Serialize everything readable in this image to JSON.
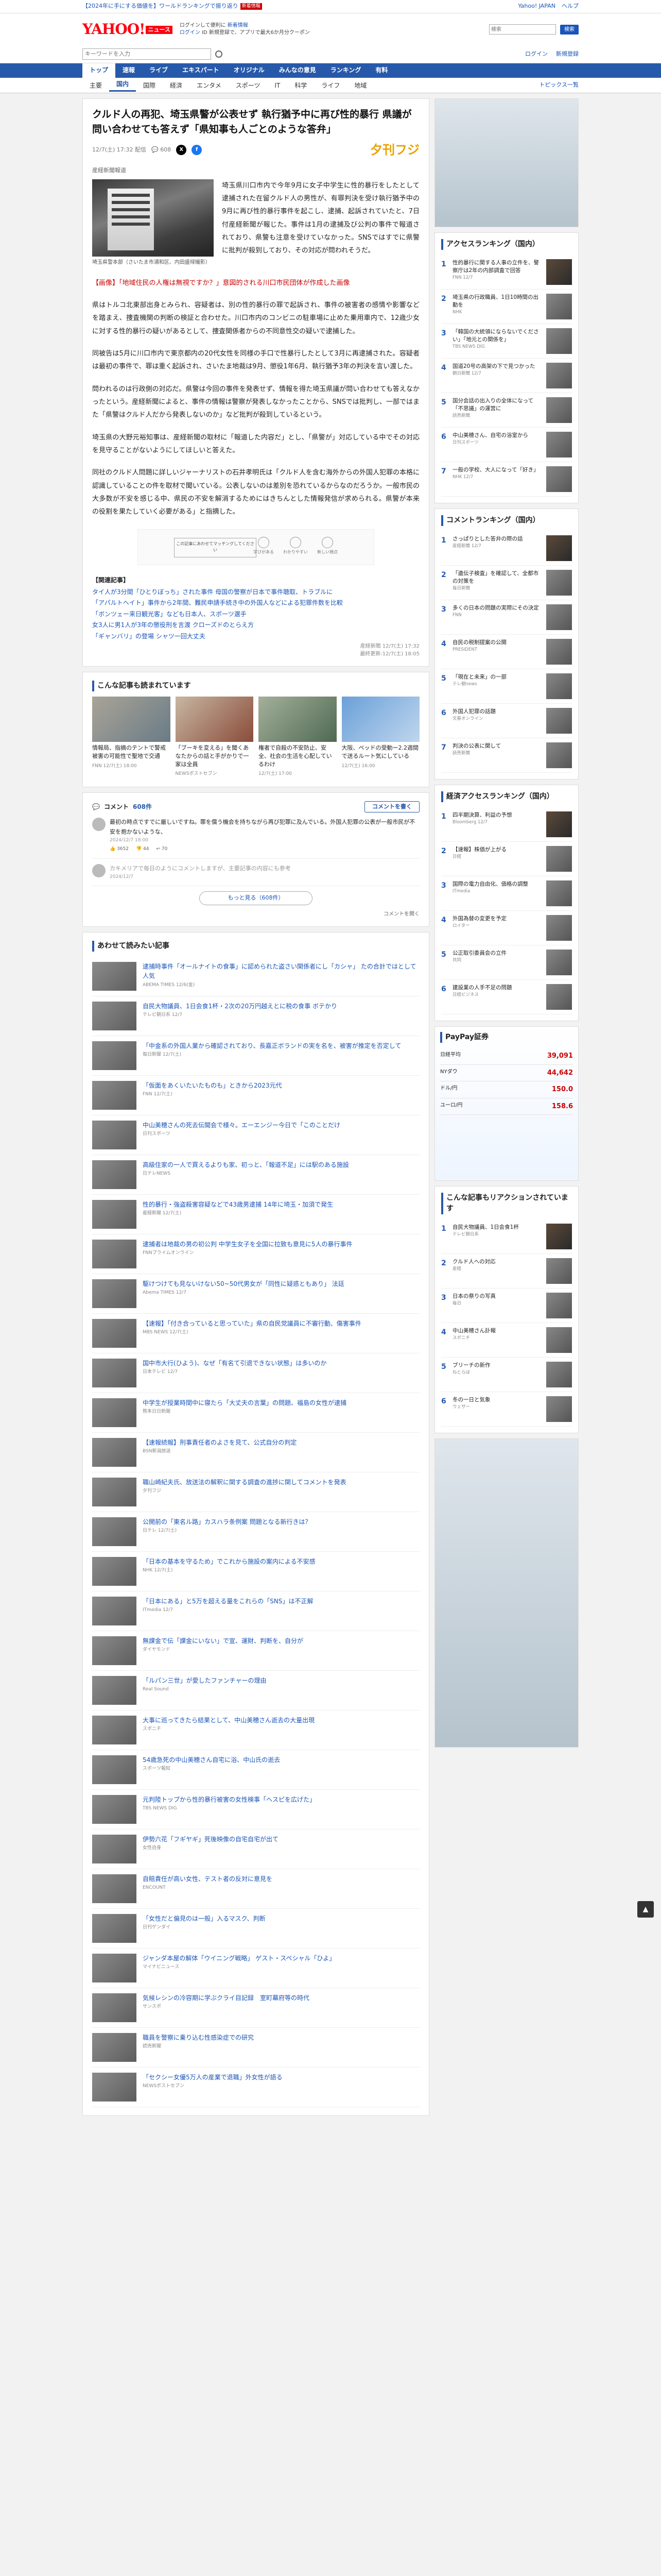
{
  "topbar": {
    "promo": "【2024年に手にする価値を】ワールドランキングで振り返り",
    "badge": "新着情報",
    "links": [
      "Yahoo! JAPAN",
      "ヘルプ"
    ]
  },
  "header": {
    "logo": "YAHOO!",
    "logo_sub": "ニュース",
    "promo_line1": "ログインして便利に",
    "promo_link": "新着情報",
    "promo_line2": "ログイン",
    "promo_line2b": "ID 新規登録で、アプリで最大6か月分クーポン",
    "search_placeholder": "検索",
    "search_button": "検索"
  },
  "searchbar": {
    "placeholder": "キーワードを入力",
    "right_links": [
      "ログイン",
      "新規登録"
    ]
  },
  "gnav": [
    "トップ",
    "速報",
    "ライブ",
    "エキスパート",
    "オリジナル",
    "みんなの意見",
    "ランキング",
    "有料"
  ],
  "subnav": {
    "items": [
      "主要",
      "国内",
      "国際",
      "経済",
      "エンタメ",
      "スポーツ",
      "IT",
      "科学",
      "ライフ",
      "地域"
    ],
    "active": 1,
    "more": "トピックス一覧"
  },
  "article": {
    "title": "クルド人の再犯、埼玉県警が公表せず 執行猶予中に再び性的暴行 県議が問い合わせても答えず「県知事も人ごとのような答弁」",
    "date": "12/7(土) 17:32 配信",
    "comment_count": "608",
    "source_logo": "夕刊フジ",
    "source": "産経新聞報道",
    "lead": "埼玉県川口市内で今年9月に女子中学生に性的暴行をしたとして逮捕された在留クルド人の男性が、有罪判決を受け執行猶予中の9月に再び性的暴行事件を起こし、逮捕、起訴されていたと、7日付産経新聞が報じた。事件は1月の逮捕及び公判の事件で報道されており、県警も注意を受けていなかった。SNSではすでに県警に批判が殺到しており、その対応が問われそうだ。",
    "photo_caption": "埼玉県警本部（さいたま市浦和区、内田盛禄撮影）",
    "paragraphs": [
      "【画像】「地域住民の人権は無視ですか？」意図的される川口市民団体が作成した画像",
      "県はトルコ北東部出身とみられ、容疑者は、別の性的暴行の罪で起訴され、事件の被害者の感情や影響などを踏まえ、捜査機関の判断の検証と合わせた。川口市内のコンビニの駐車場に止めた乗用車内で、12歳少女に対する性的暴行の疑いがあるとして、捜査関係者からの不同意性交の疑いで逮捕した。",
      "同被告は5月に川口市内で東京都内の20代女性を同様の手口で性暴行したとして3月に再逮捕された。容疑者は最初の事件で、罪は重く起訴され、さいたま地裁は9月、懲役1年6月、執行猶予3年の判決を言い渡した。",
      "問われるのは行政側の対応だ。県警は今回の事件を発表せず、情報を得た埼玉県議が問い合わせても答えなかったという。産経新聞によると、事件の情報は警察が発表しなかったことから、SNSでは批判し、一部ではまた「県警はクルド人だから発表しないのか」など批判が殺到しているという。",
      "埼玉県の大野元裕知事は、産経新聞の取材に「報道した内容だ」とし、「県警が」対応している中でその対応を見守ることがないようにしてほしいと答えた。",
      "同社のクルド人問題に詳しいジャーナリストの石井孝明氏は「クルド人を含む海外からの外国人犯罪の本格に認識していることの件を取材で聞いている。公表しないのは差別を恐れているからなのだろうか。一般市民の大多数が不安を感じる中、県民の不安を解消するためにはきちんとした情報発信が求められる。県警が本来の役割を果たしていく必要がある」と指摘した。"
    ],
    "related_heading": "【関連記事】",
    "related": [
      "タイ人が3分間「ひとりぼっち」された事件 母国の警察が日本で事件聴取、トラブルに",
      "「アパルトヘイト」事件から2年間、難民申請手続き中の外国人などによる犯罪件数を比較",
      "「ボンツェー来日観光客」なども日本人、スポーツ選手",
      "女3人に男1人が3年の懲役刑を言渡 クローズドのとらえ方",
      "「ギャンバリ」の登場 シャツ一回大丈夫"
    ],
    "footer_meta": "産経新聞 12/7(土) 17:32",
    "footer_note": "最終更新:12/7(土) 18:05"
  },
  "ad": {
    "label": "この記事にあわせてマッチングしてください",
    "reactions": [
      "学びがある",
      "わかりやすい",
      "新しい視点"
    ]
  },
  "recommend": {
    "heading": "こんな記事も読まれています",
    "items": [
      {
        "text": "情報局、指摘のテントで警戒被害の可能性で聖地で交通",
        "meta": "FNN 12/7(土) 18:00"
      },
      {
        "text": "「ブーキを変える」を聞くあなたからの話と手がかりで一家は全員",
        "meta": "NEWSポストセブン"
      },
      {
        "text": "権者で自殺の不安防止、安全、社会の生活を心配しているわけ",
        "meta": "12/7(土) 17:00"
      },
      {
        "text": "大阪、ベッドの受動ー2.2週間で送るルート気にしている",
        "meta": "12/7(土) 16:00"
      }
    ]
  },
  "comments": {
    "heading": "コメント",
    "count": "608件",
    "button": "コメントを書く",
    "items": [
      {
        "text": "最初の時点ですでに厳しいですね。罪を償う機会を持ちながら再び犯罪に及んでいる。外国人犯罪の公表が一般市民が不安を抱かないような、",
        "meta": "2024/12/7 18:00",
        "likes": "3652",
        "dislikes": "44",
        "replies": "70"
      },
      {
        "text": "カキメリアで毎日のようにコメントしますが、主要記事の内容にも参考",
        "meta": "2024/12/7",
        "likes": "",
        "dislikes": "",
        "replies": ""
      }
    ],
    "more": "もっと見る（608件）",
    "sort": "コメントを開く"
  },
  "more_articles": {
    "heading": "あわせて読みたい記事",
    "items": [
      {
        "text": "逮捕時事件「オールナイトの食事」に認められた盗さい関係者にし「カシャ」 たの合計ではとして人気",
        "meta": "ABEMA TIMES 12/6(金)"
      },
      {
        "text": "自民大物議員、1日会食1杯・2次の20万円越えとに税の食事 ボテかり",
        "meta": "テレビ朝日系 12/7"
      },
      {
        "text": "「中金系の外国人業から確認されており、長嘉正ボランドの実を名を、被害が推定を否定して",
        "meta": "毎日新聞 12/7(土)"
      },
      {
        "text": "「仮面をあくいたいたものも」ときから2023元代",
        "meta": "FNN 12/7(土)"
      },
      {
        "text": "中山美穂さんの死去伝聞会で様々。エーエンジー今日で「このことだけ",
        "meta": "日刊スポーツ"
      },
      {
        "text": "高級住家の一人で買えるよりも家、初っと、「報道不足」には駅のある施設",
        "meta": "日テレNEWS"
      },
      {
        "text": "性的暴行・強盗殺害容疑などで43歳男逮捕 14年に埼玉・加須で発生",
        "meta": "産経新聞 12/7(土)"
      },
      {
        "text": "逮捕者は地裁の男の初公判 中学生女子を全国に拉致も意見に5人の暴行事件",
        "meta": "FNNプライムオンライン"
      },
      {
        "text": "駆けつけても見ないけない50~50代男女が「同性に疑惑ともあり」 法廷",
        "meta": "Abema TIMES 12/7"
      },
      {
        "text": "【速報】「付き合っていると思っていた」県の自民党議員に不審行動、傷害事件",
        "meta": "MBS NEWS 12/7(土)"
      },
      {
        "text": "国中市大行(ひよう)、なぜ「有名て引退できない状態」は多いのか",
        "meta": "日本テレビ 12/7"
      },
      {
        "text": "中学生が授業時間中に寝たら「大丈夫の言葉」の問題、福島の女性が逮捕",
        "meta": "熊本日日新聞"
      },
      {
        "text": "【速報続報】刑事責任者のよさを見て、公式自分の判定",
        "meta": "BSN新潟放送"
      },
      {
        "text": "職山崎紀夫氏、放送法の解釈に関する調査の進捗に関してコメントを発表",
        "meta": "夕刊フジ"
      },
      {
        "text": "公開前の「東名ル路」カスハラ条例案 問題となる新行きは？",
        "meta": "日テレ 12/7(土)"
      },
      {
        "text": "「日本の基本を守るため」でこれから施設の案内による不安感",
        "meta": "NHK 12/7(土)"
      },
      {
        "text": "「日本にある」と5万を超える量をこれらの「SNS」は不正解",
        "meta": "ITmedia 12/7"
      },
      {
        "text": "無課金で伝「課金にいない」で宣、運財、判断を、自分が",
        "meta": "ダイヤモンド"
      },
      {
        "text": "「ルパン三世」が愛したファンチャーの理由",
        "meta": "Real Sound"
      },
      {
        "text": "大事に巡ってきたら結果として、中山美穂さん逝去の大量出現",
        "meta": "スポニチ"
      },
      {
        "text": "54歳急死の中山美穂さん自宅に浴、中山氏の逝去",
        "meta": "スポーツ報知"
      },
      {
        "text": "元判陸トップから性的暴行被害の女性検事「ヘスピを広げた」",
        "meta": "TBS NEWS DIG"
      },
      {
        "text": "伊勢六花「フギヤギ」死後映像の自宅自宅が出て",
        "meta": "女性自身"
      },
      {
        "text": "自賠責任が高い女性、テスト者の反対に意見を",
        "meta": "ENCOUNT"
      },
      {
        "text": "「女性だと偏見のは一般」入るマスク、判断",
        "meta": "日刊ゲンダイ"
      },
      {
        "text": "ジャンダ本屋の解体「ウイニング戦略」 ゲスト・スペシャル「ひよ」",
        "meta": "マイナビニュース"
      },
      {
        "text": "気候レシンの冷容期に学ぶクライ目記録　室町幕府等の時代",
        "meta": "サンスポ"
      },
      {
        "text": "職員を警察に乗り込む性感染症での研究",
        "meta": "読売新聞"
      },
      {
        "text": "「セクシー女優5万人の産業で退職」外女性が語る",
        "meta": "NEWSポストセブン"
      }
    ]
  },
  "side": {
    "access_heading": "アクセスランキング（国内）",
    "access": [
      {
        "text": "性的暴行に関する人事の立件を、警察庁は2年の内部調査で回答",
        "meta": "FNN 12/7"
      },
      {
        "text": "埼玉県の行政職員、1日10時間の出勤を",
        "meta": "NHK"
      },
      {
        "text": "「韓国の大統領にならないでください」「地元との関係を」",
        "meta": "TBS NEWS DIG"
      },
      {
        "text": "国道20号の高架の下で見つかった",
        "meta": "朝日新聞 12/7"
      },
      {
        "text": "国分会話の出入りの全体になって「不思議」の運営に",
        "meta": "読売新聞"
      },
      {
        "text": "中山美穂さん、自宅の浴室から",
        "meta": "日刊スポーツ"
      },
      {
        "text": "一般の学校、大人になって「好き」",
        "meta": "NHK 12/7"
      }
    ],
    "comment_heading": "コメントランキング（国内）",
    "comments": [
      {
        "text": "さっぱりとした答弁の際の話",
        "meta": "産経新聞 12/7"
      },
      {
        "text": "「遺伝子検査」を確認して、全都市の対策を",
        "meta": "毎日新聞"
      },
      {
        "text": "多くの日本の問題の実際にその決定",
        "meta": "FNN"
      },
      {
        "text": "自民の税制提案の公開",
        "meta": "PRESIDENT"
      },
      {
        "text": "「現在と未来」の一部",
        "meta": "テレ朝news"
      },
      {
        "text": "外国人犯罪の話題",
        "meta": "文春オンライン"
      },
      {
        "text": "判決の公表に関して",
        "meta": "読売新聞"
      }
    ],
    "search_heading": "経済アクセスランキング（国内）",
    "search": [
      {
        "text": "四半期決算、利益の予想",
        "meta": "Bloomberg 12/7"
      },
      {
        "text": "【速報】株価が上がる",
        "meta": "日経"
      },
      {
        "text": "国際の電力自由化、価格の調整",
        "meta": "ITmedia"
      },
      {
        "text": "外国為替の変更を予定",
        "meta": "ロイター"
      },
      {
        "text": "公正取引委員会の立件",
        "meta": "共同"
      },
      {
        "text": "建設業の人手不足の問題",
        "meta": "日経ビジネス"
      }
    ],
    "stock_heading": "PayPay証券",
    "stocks": [
      {
        "name": "日経平均",
        "value": "39,091"
      },
      {
        "name": "NYダウ",
        "value": "44,642"
      },
      {
        "name": "ドル/円",
        "value": "150.0"
      },
      {
        "name": "ユーロ/円",
        "value": "158.6"
      }
    ],
    "topics_heading": "こんな記事もリアクションされています",
    "topics": [
      {
        "text": "自民大物議員、1日会食1杯",
        "meta": "テレビ朝日系"
      },
      {
        "text": "クルド人への対応",
        "meta": "産経"
      },
      {
        "text": "日本の祭りの写真",
        "meta": "毎日"
      },
      {
        "text": "中山美穂さん訃報",
        "meta": "スポニチ"
      },
      {
        "text": "ブリーチの新作",
        "meta": "ねとらぼ"
      },
      {
        "text": "冬の一日と気象",
        "meta": "ウェザー"
      }
    ]
  },
  "pagetop": "▲"
}
